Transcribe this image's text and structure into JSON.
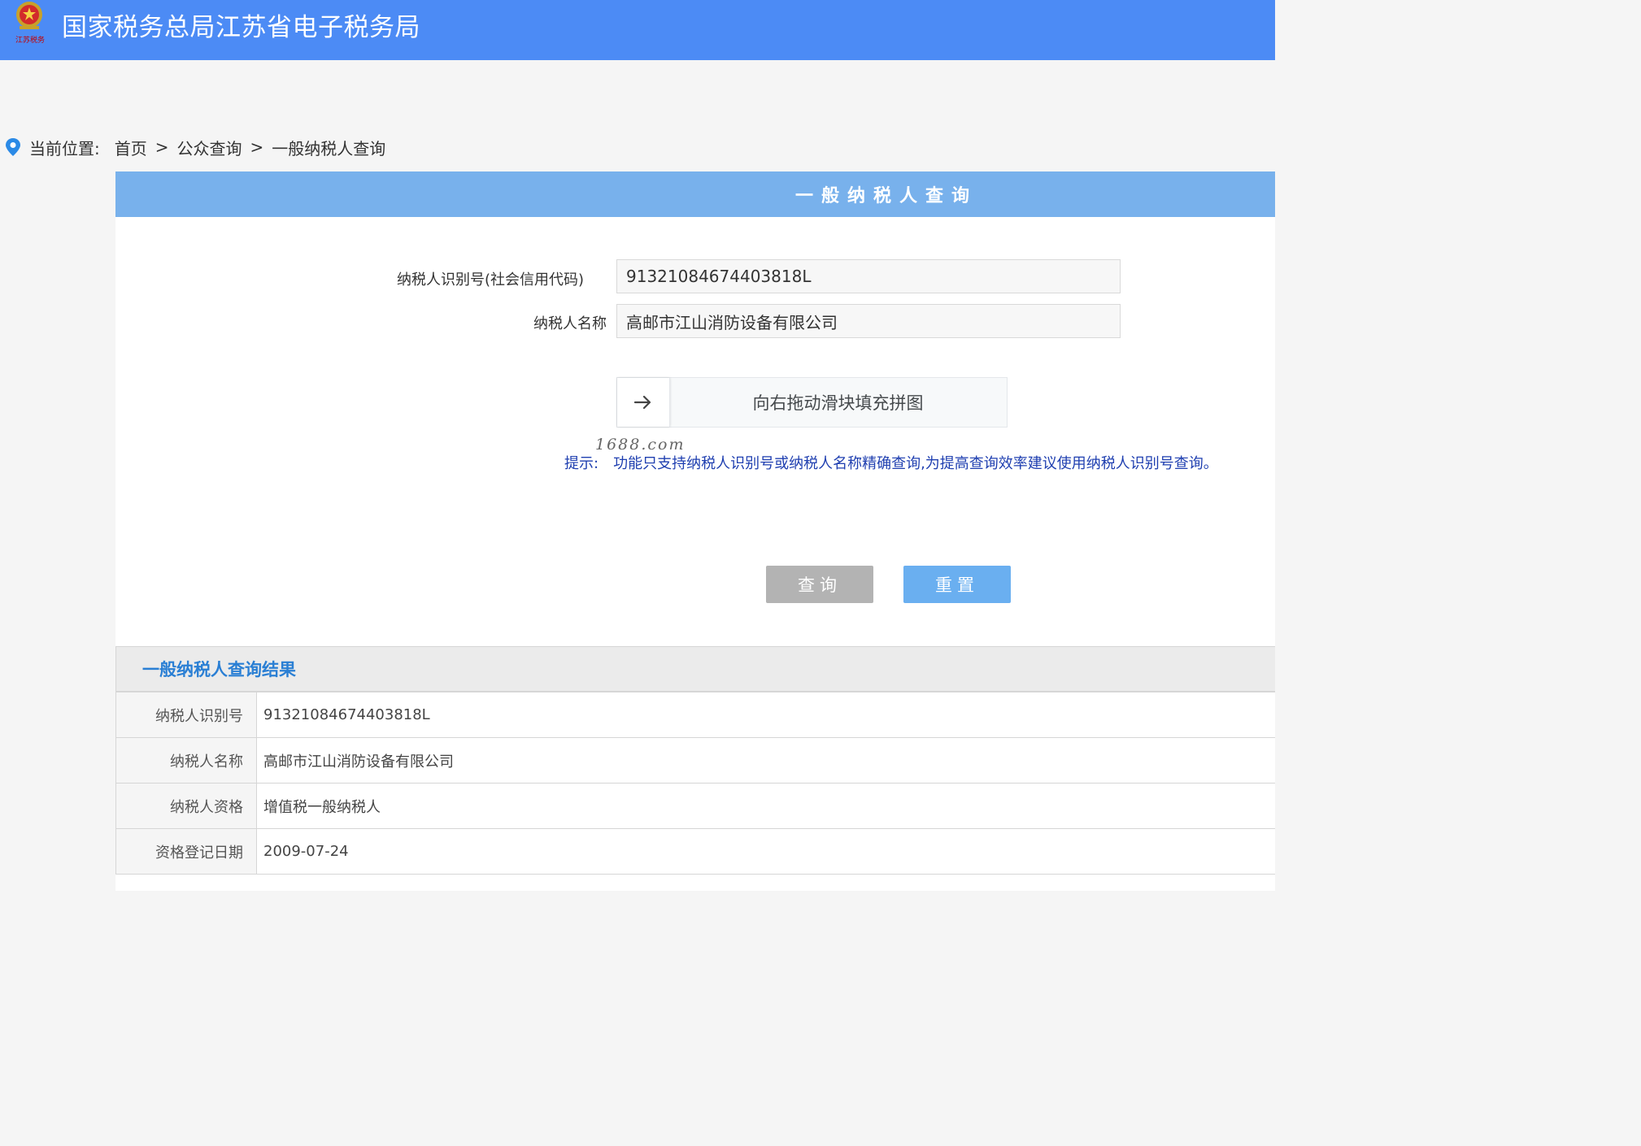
{
  "header": {
    "logo_text": "江苏税务",
    "title": "国家税务总局江苏省电子税务局",
    "color": "#4c8bf5"
  },
  "breadcrumb": {
    "label": "当前位置:",
    "items": [
      "首页",
      "公众查询",
      "一般纳税人查询"
    ],
    "separator": ">",
    "icon": "location-pin-icon"
  },
  "panel": {
    "title": "一般纳税人查询",
    "title_bg": "#78b1ec"
  },
  "form": {
    "taxpayer_id_label": "纳税人识别号(社会信用代码)",
    "taxpayer_id_value": "91321084674403818L",
    "taxpayer_name_label": "纳税人名称",
    "taxpayer_name_value": "高邮市江山消防设备有限公司",
    "slider_text": "向右拖动滑块填充拼图",
    "slider_icon": "arrow-right-icon",
    "watermark": "1688.com",
    "tip_label": "提示:",
    "tip_text": "功能只支持纳税人识别号或纳税人名称精确查询,为提高查询效率建议使用纳税人识别号查询。"
  },
  "buttons": {
    "query": "查询",
    "reset": "重置"
  },
  "result": {
    "title": "一般纳税人查询结果",
    "rows": [
      {
        "key": "纳税人识别号",
        "value": "91321084674403818L"
      },
      {
        "key": "纳税人名称",
        "value": "高邮市江山消防设备有限公司"
      },
      {
        "key": "纳税人资格",
        "value": "增值税一般纳税人"
      },
      {
        "key": "资格登记日期",
        "value": "2009-07-24"
      }
    ]
  }
}
